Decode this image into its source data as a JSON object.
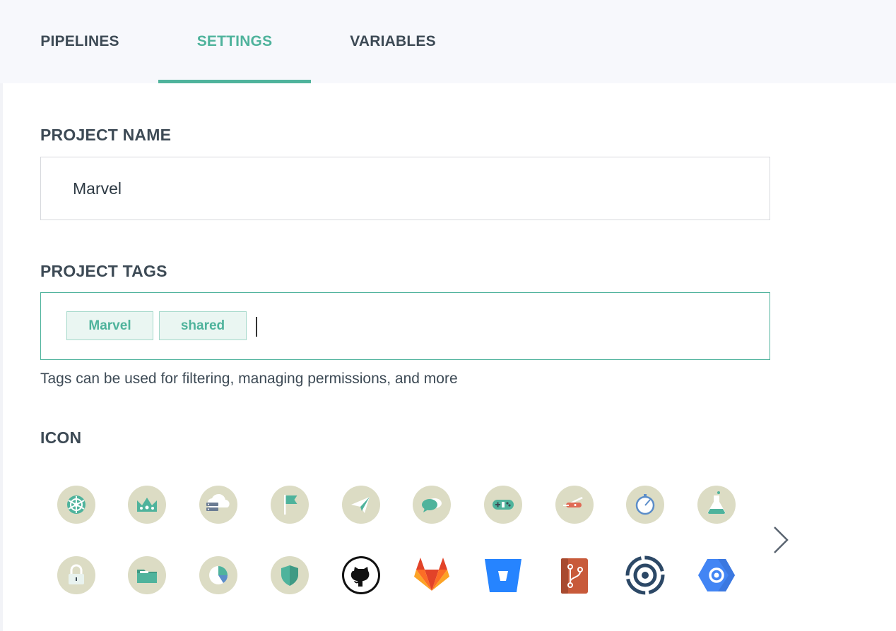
{
  "tabs": [
    {
      "label": "PIPELINES",
      "active": false
    },
    {
      "label": "SETTINGS",
      "active": true
    },
    {
      "label": "VARIABLES",
      "active": false
    }
  ],
  "project_name": {
    "label": "PROJECT NAME",
    "value": "Marvel"
  },
  "project_tags": {
    "label": "PROJECT TAGS",
    "tags": [
      "Marvel",
      "shared"
    ],
    "hint": "Tags can be used for filtering, managing permissions, and more"
  },
  "icon_section": {
    "label": "ICON",
    "icons_row1": [
      "kubernetes-helm-icon",
      "crown-icon",
      "cloud-server-icon",
      "flag-icon",
      "paper-plane-icon",
      "chat-bubbles-icon",
      "gamepad-icon",
      "swiss-knife-icon",
      "stopwatch-icon",
      "flask-icon"
    ],
    "icons_row2": [
      "padlock-icon",
      "folder-icon",
      "pie-chart-icon",
      "shield-icon",
      "github-icon",
      "gitlab-icon",
      "bitbucket-icon",
      "git-repository-icon",
      "circular-target-icon",
      "google-cloud-icon"
    ],
    "next_icon": "chevron-right-icon"
  },
  "colors": {
    "accent": "#4fb39c",
    "icon_background": "#dcdcc4",
    "text": "#3d4a55"
  }
}
